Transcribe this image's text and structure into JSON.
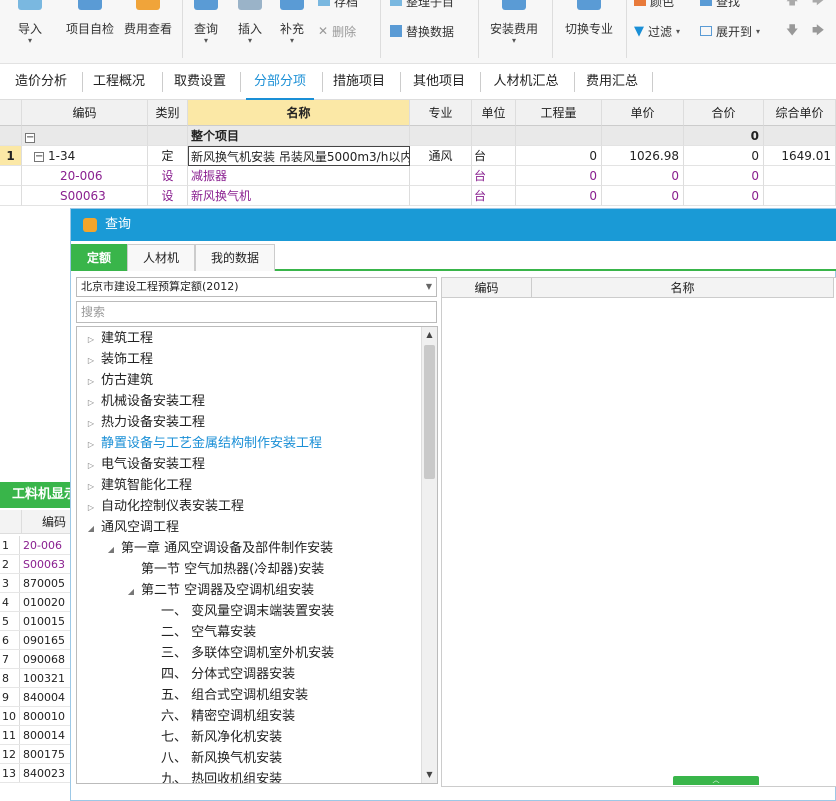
{
  "ribbon": {
    "import_label": "导入",
    "self_check_label": "项目自检",
    "fee_check_label": "费用查看",
    "query_label": "查询",
    "insert_label": "插入",
    "supplement_label": "补充",
    "save_label": "存档",
    "delete_label": "删除",
    "organize_label": "整理子目",
    "replace_data_label": "替换数据",
    "install_fee_label": "安装费用",
    "switch_major_label": "切换专业",
    "color_label": "颜色",
    "find_label": "查找",
    "filter_label": "过滤",
    "expand_label": "展开到"
  },
  "tabs": [
    {
      "label": "造价分析"
    },
    {
      "label": "工程概况"
    },
    {
      "label": "取费设置"
    },
    {
      "label": "分部分项"
    },
    {
      "label": "措施项目"
    },
    {
      "label": "其他项目"
    },
    {
      "label": "人材机汇总"
    },
    {
      "label": "费用汇总"
    }
  ],
  "grid": {
    "headers": [
      "编码",
      "类别",
      "名称",
      "专业",
      "单位",
      "工程量",
      "单价",
      "合价",
      "综合单价"
    ],
    "summary": {
      "name": "整个项目",
      "total": "0"
    },
    "rows": [
      {
        "idx": "1",
        "code": "1-34",
        "type": "定",
        "name": "新风换气机安装 吊装风量5000m3/h以内",
        "major": "通风",
        "unit": "台",
        "qty": "0",
        "price": "1026.98",
        "total": "0",
        "comp": "1649.01"
      },
      {
        "idx": "",
        "code": "20-006",
        "type": "设",
        "name": "减振器",
        "major": "",
        "unit": "台",
        "qty": "0",
        "price": "0",
        "total": "0",
        "comp": ""
      },
      {
        "idx": "",
        "code": "S00063",
        "type": "设",
        "name": "新风换气机",
        "major": "",
        "unit": "台",
        "qty": "0",
        "price": "0",
        "total": "0",
        "comp": ""
      }
    ]
  },
  "leftpane": {
    "title": "工料机显示",
    "col_header": "编码",
    "rows": [
      {
        "n": "1",
        "code": "20-006"
      },
      {
        "n": "2",
        "code": "S00063"
      },
      {
        "n": "3",
        "code": "870005"
      },
      {
        "n": "4",
        "code": "010020"
      },
      {
        "n": "5",
        "code": "010015"
      },
      {
        "n": "6",
        "code": "090165"
      },
      {
        "n": "7",
        "code": "090068"
      },
      {
        "n": "8",
        "code": "100321"
      },
      {
        "n": "9",
        "code": "840004"
      },
      {
        "n": "10",
        "code": "800010"
      },
      {
        "n": "11",
        "code": "800014"
      },
      {
        "n": "12",
        "code": "800175"
      },
      {
        "n": "13",
        "code": "840023"
      }
    ]
  },
  "dialog": {
    "title": "查询",
    "tabs": [
      "定额",
      "人材机",
      "我的数据"
    ],
    "quota_library": "北京市建设工程预算定额(2012)",
    "search_placeholder": "搜索",
    "tree": [
      {
        "label": "建筑工程",
        "twisty": "▷"
      },
      {
        "label": "装饰工程",
        "twisty": "▷"
      },
      {
        "label": "仿古建筑",
        "twisty": "▷"
      },
      {
        "label": "机械设备安装工程",
        "twisty": "▷"
      },
      {
        "label": "热力设备安装工程",
        "twisty": "▷"
      },
      {
        "label": "静置设备与工艺金属结构制作安装工程",
        "twisty": "▷"
      },
      {
        "label": "电气设备安装工程",
        "twisty": "▷"
      },
      {
        "label": "建筑智能化工程",
        "twisty": "▷"
      },
      {
        "label": "自动化控制仪表安装工程",
        "twisty": "▷"
      },
      {
        "label": "通风空调工程",
        "twisty": "◢"
      },
      {
        "label": "第一章 通风空调设备及部件制作安装",
        "twisty": "◢"
      },
      {
        "label": "第一节 空气加热器(冷却器)安装",
        "twisty": ""
      },
      {
        "label": "第二节 空调器及空调机组安装",
        "twisty": "◢"
      },
      {
        "label": "一、 变风量空调末端装置安装",
        "twisty": ""
      },
      {
        "label": "二、 空气幕安装",
        "twisty": ""
      },
      {
        "label": "三、 多联体空调机室外机安装",
        "twisty": ""
      },
      {
        "label": "四、 分体式空调器安装",
        "twisty": ""
      },
      {
        "label": "五、 组合式空调机组安装",
        "twisty": ""
      },
      {
        "label": "六、 精密空调机组安装",
        "twisty": ""
      },
      {
        "label": "七、 新风净化机安装",
        "twisty": ""
      },
      {
        "label": "八、 新风换气机安装",
        "twisty": ""
      },
      {
        "label": "九、 热回收机组安装",
        "twisty": ""
      }
    ],
    "result_headers": [
      "编码",
      "名称"
    ]
  },
  "colors": {
    "accent_blue": "#1a9ad6",
    "accent_green": "#39b54a",
    "highlight_header": "#fbe8a6",
    "device_purple": "#8a2090"
  }
}
